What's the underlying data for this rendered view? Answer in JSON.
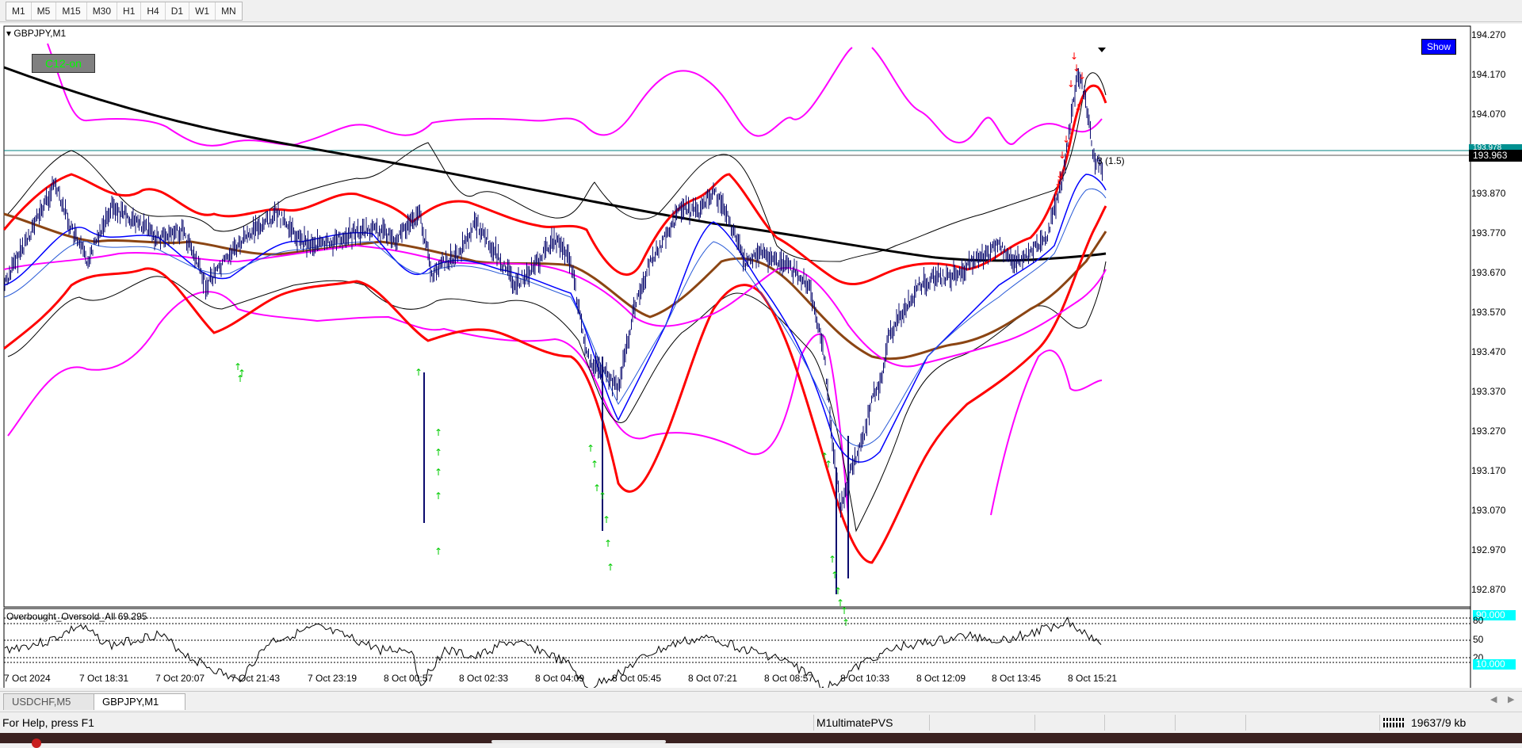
{
  "toolbar": {
    "timeframes": [
      "M1",
      "M5",
      "M15",
      "M30",
      "H1",
      "H4",
      "D1",
      "W1",
      "MN"
    ]
  },
  "chart": {
    "symbol_title": "GBPJPY,M1",
    "expert_badge": "C12-on",
    "show_button": "Show",
    "spread_label": "3 (1.5)",
    "current_price": "193.963",
    "ask_price": "193.978",
    "price_axis": [
      "194.270",
      "194.170",
      "194.070",
      "193.870",
      "193.770",
      "193.670",
      "193.570",
      "193.470",
      "193.370",
      "193.270",
      "193.170",
      "193.070",
      "192.970",
      "192.870"
    ],
    "time_axis": [
      "7 Oct 2024",
      "7 Oct 18:31",
      "7 Oct 20:07",
      "7 Oct 21:43",
      "7 Oct 23:19",
      "8 Oct 00:57",
      "8 Oct 02:33",
      "8 Oct 04:09",
      "8 Oct 05:45",
      "8 Oct 07:21",
      "8 Oct 08:57",
      "8 Oct 10:33",
      "8 Oct 12:09",
      "8 Oct 13:45",
      "8 Oct 15:21"
    ],
    "colors": {
      "candles": "#0a0a6e",
      "envelope_red": "#ff0000",
      "envelope_magenta": "#ff00ff",
      "ma_blue": "#0000ff",
      "ma_brown": "#8b4513",
      "ma_black": "#000000",
      "buy_arrow": "#00cc00",
      "sell_arrow": "#ff0000",
      "level_line": "#008080"
    }
  },
  "oscillator": {
    "title": "Overbought_Oversold_All 69.295",
    "level_high": "90.000",
    "level_80": "80",
    "level_50": "50",
    "level_20": "20",
    "level_low": "10.000"
  },
  "tabs": [
    "USDCHF,M5",
    "GBPJPY,M1"
  ],
  "status": {
    "help": "For Help, press F1",
    "profile": "M1ultimatePVS",
    "traffic": "19637/9 kb"
  }
}
